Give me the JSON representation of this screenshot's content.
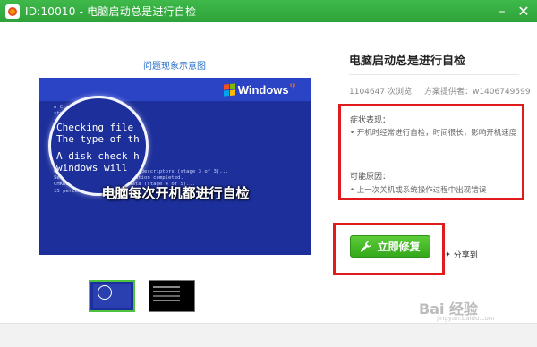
{
  "window": {
    "title": "ID:10010 - 电脑启动总是进行自检",
    "min_icon": "minimize-icon",
    "close_icon": "close-icon"
  },
  "demo": {
    "caption": "问题现象示意图",
    "brand": "Windows",
    "brand_suffix": "xp",
    "magnified_lines": [
      "Checking file",
      "The type of th",
      "A disk check h",
      "windows will"
    ],
    "small_lines": [
      "n C:",
      "stem is NTFS.",
      "",
      "scheduled.",
      "the disk.",
      "",
      "les (stage 1 of 3)...",
      "mpleted.",
      "indexes (stage 2 of 3)...",
      "completed.",
      "CHKDSK is verifying security descriptors (stage 3 of 3)...",
      "Security descriptor verification completed.",
      "CHKDSK is verifying file data (stage 4 of 5)...",
      "15 percent completed."
    ],
    "overlay": "电脑每次开机都进行自检"
  },
  "thumbnails": [
    {
      "name": "thumbnail-1",
      "selected": true
    },
    {
      "name": "thumbnail-2",
      "selected": false
    }
  ],
  "article": {
    "title": "电脑启动总是进行自检",
    "views": "1104647 次浏览",
    "provider": "方案提供者：w1406749599"
  },
  "symptoms": {
    "label": "症状表现：",
    "items": [
      "开机时经常进行自检，时间很长，影响开机速度"
    ]
  },
  "causes": {
    "label": "可能原因：",
    "items": [
      "上一次关机或系统操作过程中出现错误"
    ]
  },
  "actions": {
    "fix_label": "立即修复",
    "share_label": "分享到"
  },
  "watermark": {
    "text": "Bai 经验",
    "sub": "jingyan.baidu.com"
  },
  "colors": {
    "titlebar": "#35ad40",
    "highlight": "#e01b1b",
    "button": "#45b82a",
    "screen": "#1d2f9a"
  }
}
